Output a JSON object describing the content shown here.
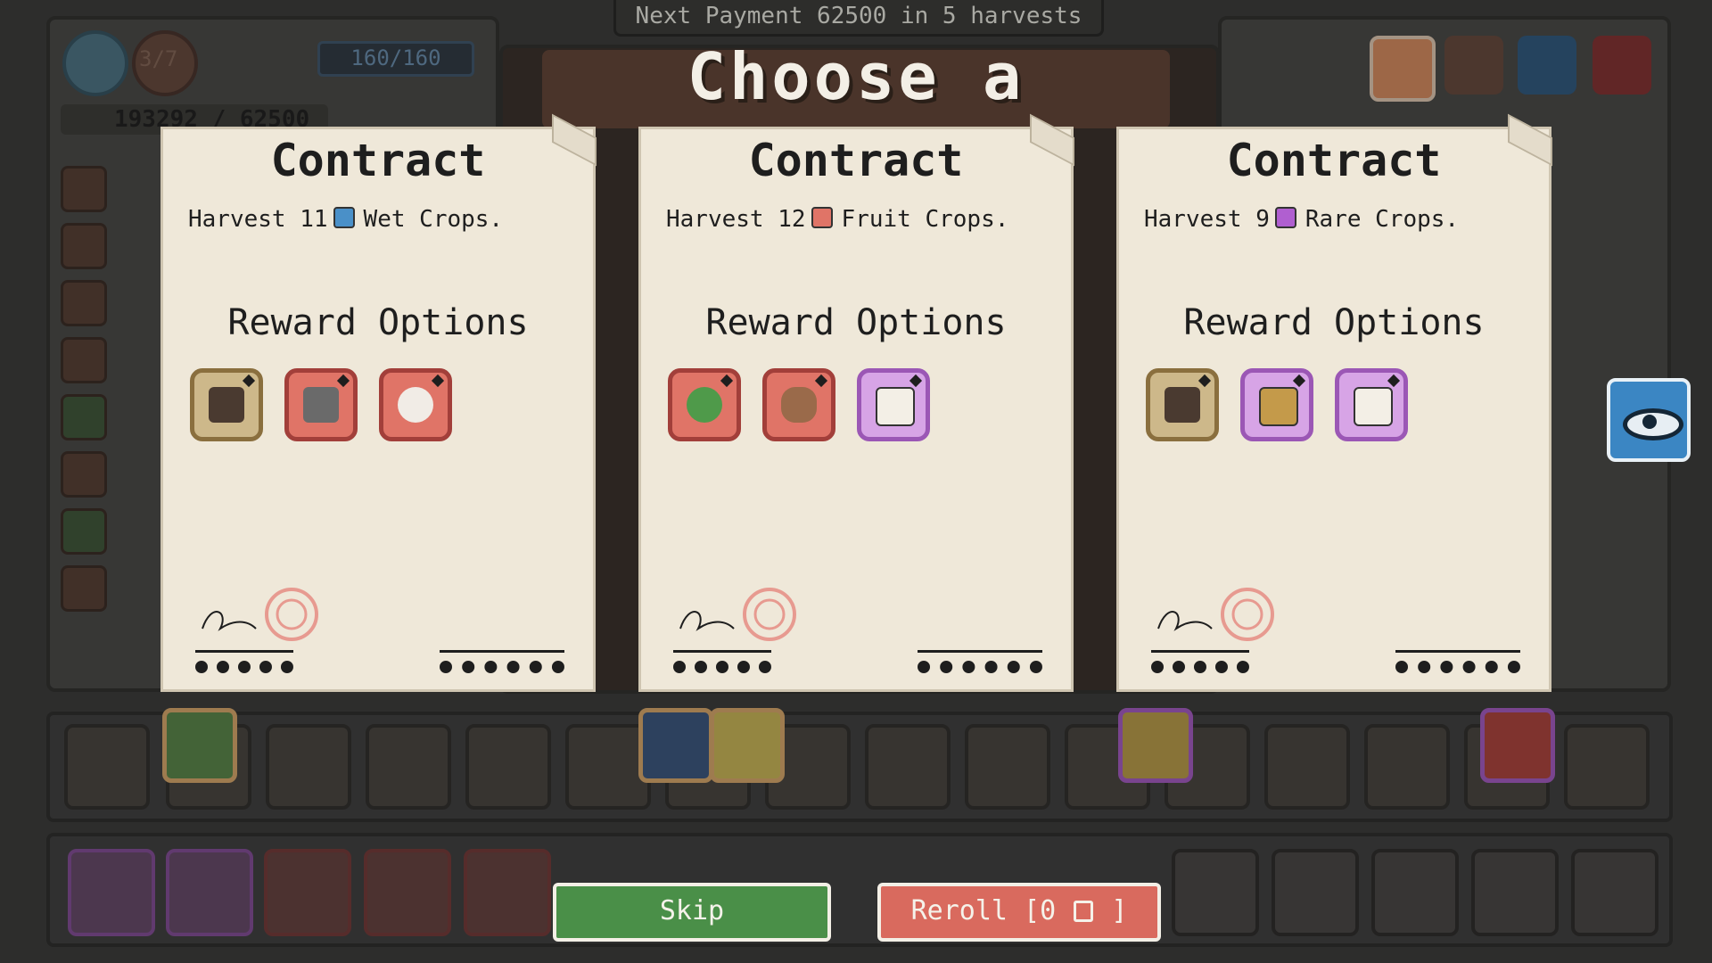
{
  "header": {
    "payment_text": "Next Payment 62500 in 5 harvests",
    "title": "Choose a contract",
    "round_badge": "3/7",
    "energy": "160/160",
    "money": "193292 / 62500"
  },
  "contracts": [
    {
      "title": "Contract",
      "verb": "Harvest 11",
      "crop_type": "Wet Crops.",
      "gem_color": "#4a90c8",
      "reward_heading": "Reward Options",
      "rewards": [
        {
          "name": "shrine-reward-icon",
          "rarity": "gold"
        },
        {
          "name": "cat-reward-icon",
          "rarity": "red"
        },
        {
          "name": "rabbit-reward-icon",
          "rarity": "red"
        }
      ]
    },
    {
      "title": "Contract",
      "verb": "Harvest 12",
      "crop_type": "Fruit Crops.",
      "gem_color": "#e07467",
      "reward_heading": "Reward Options",
      "rewards": [
        {
          "name": "frog-reward-icon",
          "rarity": "red"
        },
        {
          "name": "guinea-pig-reward-icon",
          "rarity": "red"
        },
        {
          "name": "water-card-reward-icon",
          "rarity": "purple"
        }
      ]
    },
    {
      "title": "Contract",
      "verb": "Harvest 9",
      "crop_type": "Rare Crops.",
      "gem_color": "#b05fd0",
      "reward_heading": "Reward Options",
      "rewards": [
        {
          "name": "shrine-reward-icon",
          "rarity": "gold"
        },
        {
          "name": "fence-card-reward-icon",
          "rarity": "purple"
        },
        {
          "name": "seed-bag-card-reward-icon",
          "rarity": "purple"
        }
      ]
    }
  ],
  "buttons": {
    "skip": "Skip",
    "reroll": "Reroll [0",
    "reroll_end": "]"
  },
  "colors": {
    "gold": "#cdb88a",
    "red": "#e07467",
    "purple": "#d7a4e6",
    "skip": "#4a8f48",
    "reroll": "#d96a5e",
    "eye": "#3b86c3"
  }
}
